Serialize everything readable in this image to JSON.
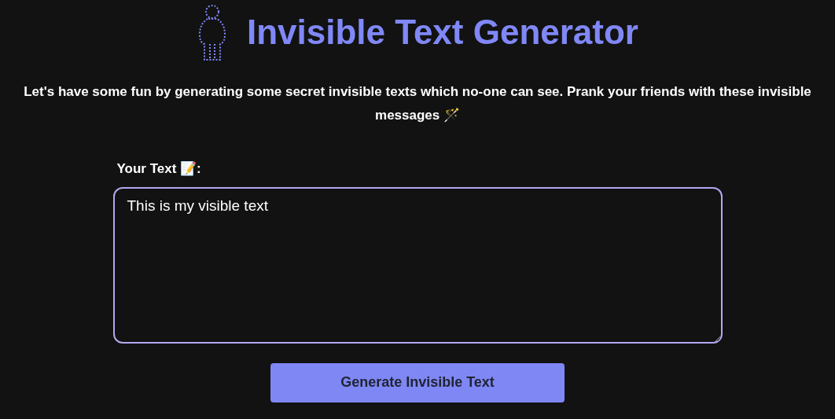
{
  "header": {
    "title": "Invisible Text Generator"
  },
  "description": "Let's have some fun by generating some secret invisible texts which no-one can see. Prank your friends with these invisible messages 🪄",
  "form": {
    "label": "Your Text 📝:",
    "value": "This is my visible text"
  },
  "button": "Generate Invisible Text"
}
